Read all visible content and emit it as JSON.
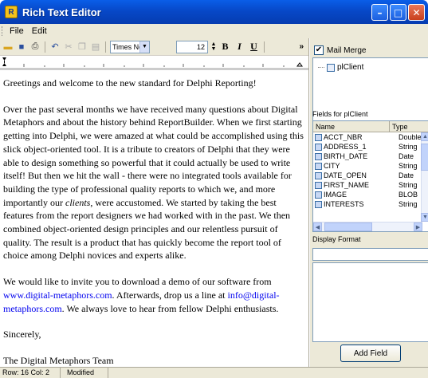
{
  "window": {
    "title": "Rich Text Editor",
    "app_icon_letter": "R"
  },
  "menu": {
    "items": [
      "File",
      "Edit"
    ]
  },
  "toolbar": {
    "font_name": "Times Ne",
    "font_size": "12",
    "bold_label": "B",
    "italic_label": "I",
    "underline_label": "U",
    "more_label": "»"
  },
  "editor": {
    "p1": "Greetings and welcome to the new standard for Delphi Reporting!",
    "p2a": "Over the past several months we have received many questions about Digital Metaphors and about the history behind ReportBuilder. When we first starting getting into Delphi, we were amazed at what could be accomplished using this slick object-oriented tool. It is a tribute to creators of Delphi that they were able to design something so powerful that it could actually be used to write itself! But then we hit the wall - there were no integrated tools available for building the type of professional quality reports to which we, and more importantly our ",
    "p2_italic": "clients",
    "p2b": ", were accustomed. We started by taking the best features from the report designers we had worked with in the past. We then combined object-oriented design principles and our relentless pursuit of quality. The result is a product that has quickly become the report tool of choice among Delphi novices and experts alike.",
    "p3a": "We would like to invite you to download a demo of our software from ",
    "p3_link1": "www.digital-metaphors.com",
    "p3b": ". Afterwards, drop us a line at ",
    "p3_link2": "info@digital-metaphors.com",
    "p3c": ". We always love to hear from fellow Delphi enthusiasts.",
    "p4": "Sincerely,",
    "p5": "The Digital Metaphors Team"
  },
  "panel": {
    "mail_merge_label": "Mail Merge",
    "mail_merge_checked": true,
    "pipeline_name": "plClient",
    "fields_label": "Fields for plClient",
    "col_name": "Name",
    "col_type": "Type",
    "fields": [
      {
        "name": "ACCT_NBR",
        "type": "Double"
      },
      {
        "name": "ADDRESS_1",
        "type": "String"
      },
      {
        "name": "BIRTH_DATE",
        "type": "Date"
      },
      {
        "name": "CITY",
        "type": "String"
      },
      {
        "name": "DATE_OPEN",
        "type": "Date"
      },
      {
        "name": "FIRST_NAME",
        "type": "String"
      },
      {
        "name": "IMAGE",
        "type": "BLOB"
      },
      {
        "name": "INTERESTS",
        "type": "String"
      }
    ],
    "display_format_label": "Display Format",
    "display_format_value": "",
    "add_field_label": "Add Field"
  },
  "status": {
    "position": "Row: 16  Col: 2",
    "modified": "Modified"
  },
  "colors": {
    "titlebar": "#0a5ee8",
    "link": "#0000ee",
    "chrome": "#ece9d8"
  }
}
